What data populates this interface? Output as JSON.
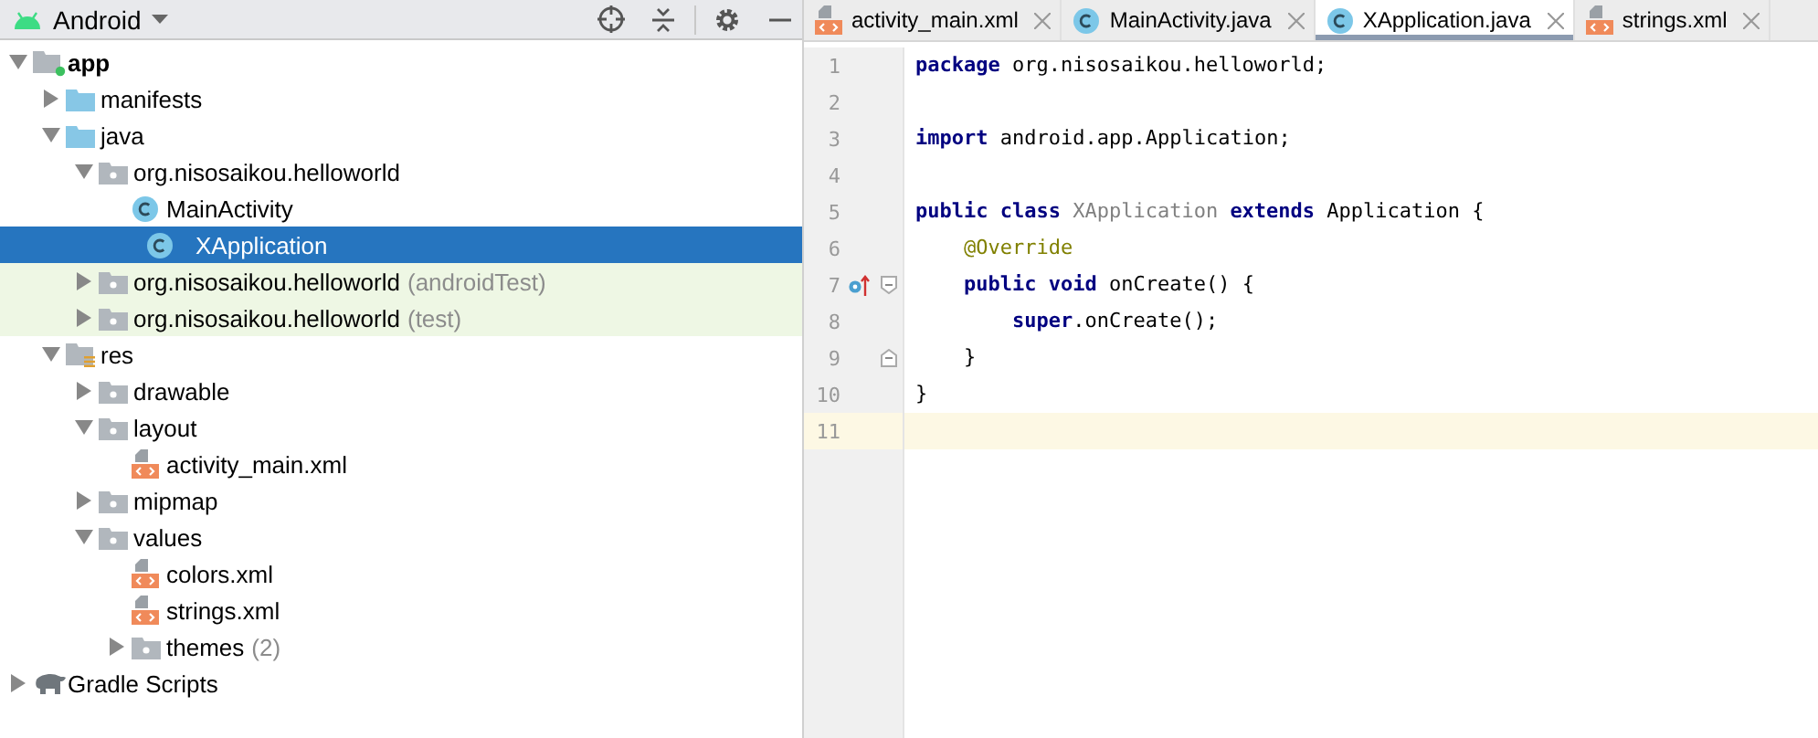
{
  "project_panel": {
    "view_selector": "Android",
    "tree": [
      {
        "label": "app",
        "kind": "module",
        "expanded": true,
        "selected": false,
        "test": false,
        "children": [
          {
            "label": "manifests",
            "kind": "folder",
            "expanded": false,
            "selected": false,
            "test": false
          },
          {
            "label": "java",
            "kind": "folder",
            "expanded": true,
            "selected": false,
            "test": false,
            "children": [
              {
                "label": "org.nisosaikou.helloworld",
                "kind": "package",
                "expanded": true,
                "selected": false,
                "test": false,
                "children": [
                  {
                    "label": "MainActivity",
                    "kind": "class",
                    "selected": false,
                    "test": false
                  },
                  {
                    "label": "XApplication",
                    "kind": "class",
                    "selected": true
                  }
                ]
              },
              {
                "label": "org.nisosaikou.helloworld",
                "suffix": "(androidTest)",
                "kind": "package",
                "expanded": false,
                "selected": false,
                "test": true
              },
              {
                "label": "org.nisosaikou.helloworld",
                "suffix": "(test)",
                "kind": "package",
                "expanded": false,
                "selected": false,
                "test": true
              }
            ]
          },
          {
            "label": "res",
            "kind": "res",
            "expanded": true,
            "selected": false,
            "test": false,
            "children": [
              {
                "label": "drawable",
                "kind": "package",
                "expanded": false,
                "selected": false,
                "test": false
              },
              {
                "label": "layout",
                "kind": "package",
                "expanded": true,
                "selected": false,
                "test": false,
                "children": [
                  {
                    "label": "activity_main.xml",
                    "kind": "xml",
                    "selected": false,
                    "test": false
                  }
                ]
              },
              {
                "label": "mipmap",
                "kind": "package",
                "expanded": false,
                "selected": false,
                "test": false
              },
              {
                "label": "values",
                "kind": "package",
                "expanded": true,
                "selected": false,
                "test": false,
                "children": [
                  {
                    "label": "colors.xml",
                    "kind": "xml",
                    "selected": false,
                    "test": false
                  },
                  {
                    "label": "strings.xml",
                    "kind": "xml",
                    "selected": false,
                    "test": false
                  },
                  {
                    "label": "themes",
                    "suffix": "(2)",
                    "kind": "package",
                    "expanded": false,
                    "selected": false,
                    "test": false
                  }
                ]
              }
            ]
          }
        ]
      },
      {
        "label": "Gradle Scripts",
        "kind": "gradle",
        "expanded": false,
        "selected": false,
        "test": false
      }
    ]
  },
  "editor": {
    "tabs": [
      {
        "label": "activity_main.xml",
        "kind": "xml",
        "selected": false
      },
      {
        "label": "MainActivity.java",
        "kind": "class",
        "selected": false
      },
      {
        "label": "XApplication.java",
        "kind": "class",
        "selected": true
      },
      {
        "label": "strings.xml",
        "kind": "xml",
        "selected": false
      }
    ],
    "lines": [
      {
        "number": "1",
        "current": false,
        "overrides": false,
        "fold_start": false,
        "fold_end": false,
        "tokens": [
          {
            "text": "package",
            "kind": "keyword"
          },
          {
            "text": " org.nisosaikou.helloworld;",
            "kind": "plain"
          }
        ]
      },
      {
        "number": "2",
        "current": false,
        "overrides": false,
        "fold_start": false,
        "fold_end": false
      },
      {
        "number": "3",
        "current": false,
        "overrides": false,
        "fold_start": false,
        "fold_end": false,
        "tokens": [
          {
            "text": "import",
            "kind": "keyword"
          },
          {
            "text": " android.app.Application;",
            "kind": "plain"
          }
        ]
      },
      {
        "number": "4",
        "current": false,
        "overrides": false,
        "fold_start": false,
        "fold_end": false
      },
      {
        "number": "5",
        "current": false,
        "overrides": false,
        "fold_start": false,
        "fold_end": false,
        "tokens": [
          {
            "text": "public class ",
            "kind": "keyword"
          },
          {
            "text": "XApplication ",
            "kind": "unused"
          },
          {
            "text": "extends",
            "kind": "keyword"
          },
          {
            "text": " Application {",
            "kind": "plain"
          }
        ]
      },
      {
        "number": "6",
        "current": false,
        "overrides": false,
        "fold_start": false,
        "fold_end": false,
        "tokens": [
          {
            "text": "    @Override",
            "kind": "annotation"
          }
        ]
      },
      {
        "number": "7",
        "current": false,
        "overrides": true,
        "fold_start": true,
        "fold_end": false,
        "tokens": [
          {
            "text": "    public void",
            "kind": "keyword"
          },
          {
            "text": " onCreate() {",
            "kind": "plain"
          }
        ]
      },
      {
        "number": "8",
        "current": false,
        "overrides": false,
        "fold_start": false,
        "fold_end": false,
        "tokens": [
          {
            "text": "        super",
            "kind": "keyword"
          },
          {
            "text": ".onCreate();",
            "kind": "plain"
          }
        ]
      },
      {
        "number": "9",
        "current": false,
        "overrides": false,
        "fold_start": false,
        "fold_end": true,
        "tokens": [
          {
            "text": "    }",
            "kind": "plain"
          }
        ]
      },
      {
        "number": "10",
        "current": false,
        "overrides": false,
        "fold_start": false,
        "fold_end": false,
        "tokens": [
          {
            "text": "}",
            "kind": "plain"
          }
        ]
      },
      {
        "number": "11",
        "current": true,
        "overrides": false,
        "fold_start": false,
        "fold_end": false
      }
    ]
  }
}
